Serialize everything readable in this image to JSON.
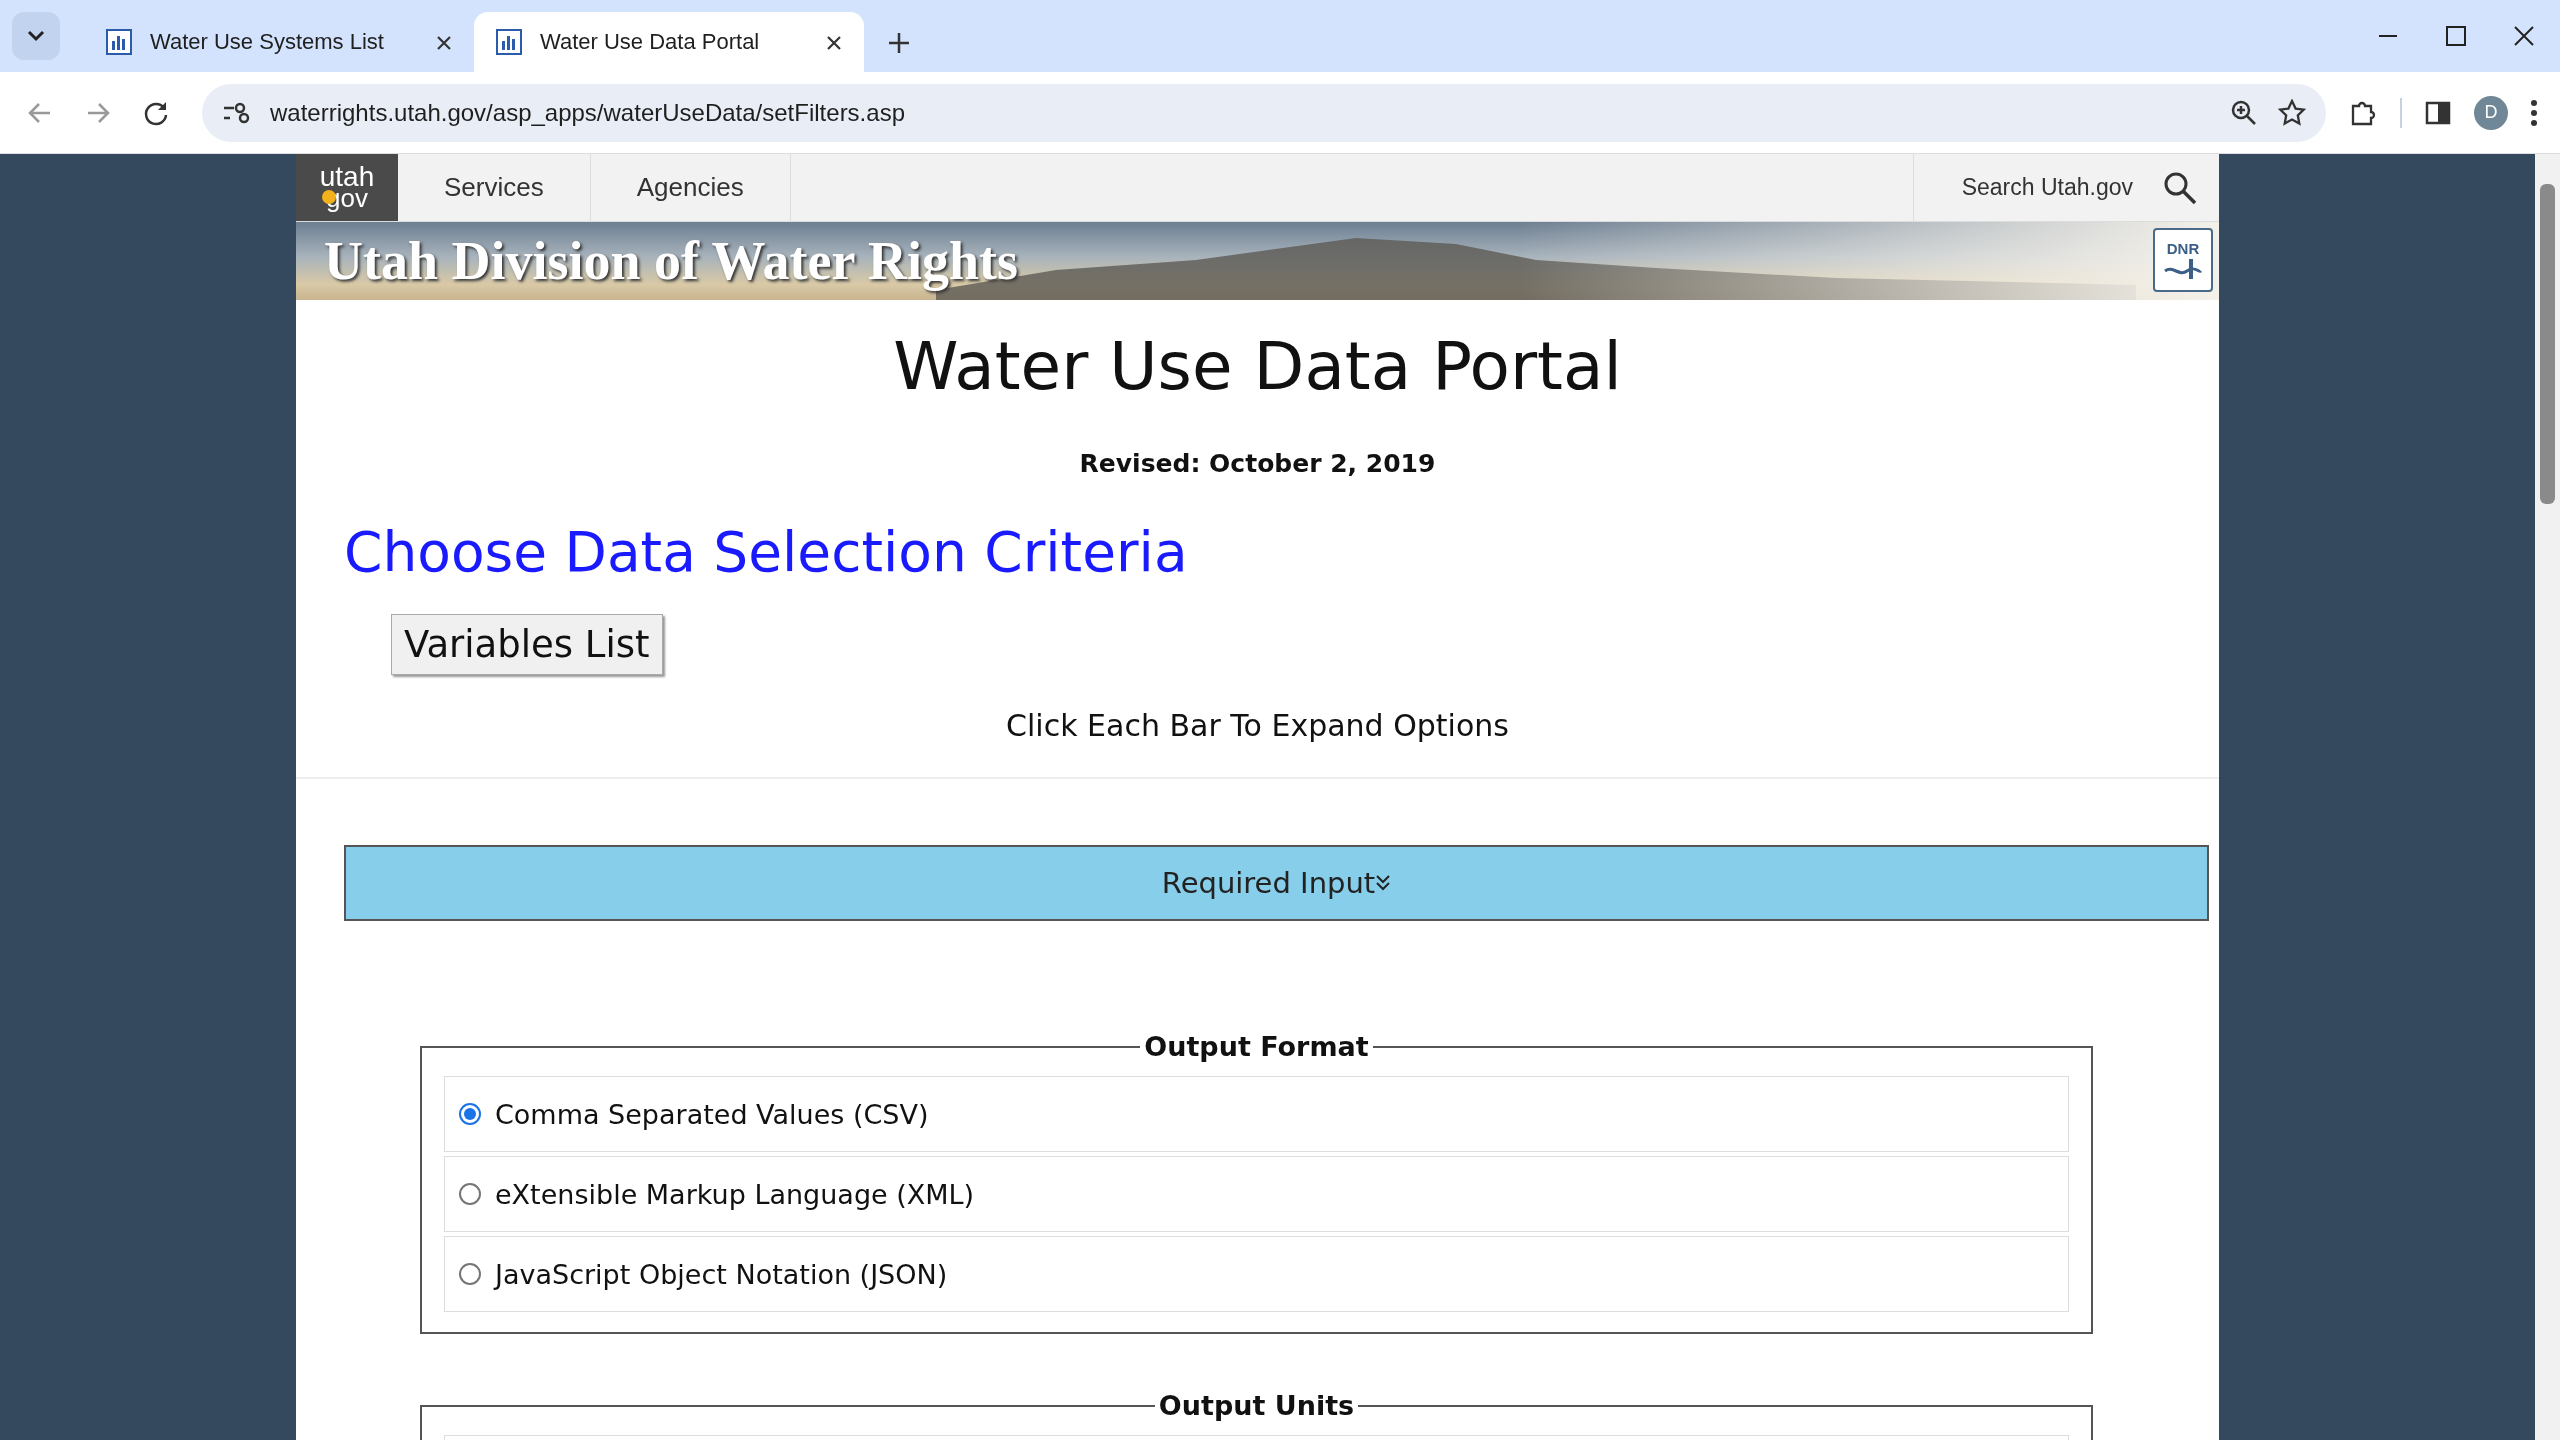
{
  "browser": {
    "tabs": [
      {
        "title": "Water Use Systems List",
        "selected": false
      },
      {
        "title": "Water Use Data Portal",
        "selected": true
      }
    ],
    "url": "waterrights.utah.gov/asp_apps/waterUseData/setFilters.asp",
    "profile_initial": "D"
  },
  "site_header": {
    "logo": {
      "top": "utah",
      "bottom": "gov"
    },
    "nav": [
      "Services",
      "Agencies"
    ],
    "search_label": "Search Utah.gov",
    "banner_title": "Utah Division of Water Rights",
    "badge": "DNR"
  },
  "page": {
    "title": "Water Use Data Portal",
    "revised": "Revised: October 2, 2019",
    "heading": "Choose Data Selection Criteria",
    "variables_button": "Variables List",
    "instructions": "Click Each Bar To Expand Options",
    "sections": [
      {
        "label": "Required Input",
        "expanded": true
      }
    ],
    "fieldsets": [
      {
        "legend": "Output Format",
        "options": [
          {
            "label": "Comma Separated Values (CSV)",
            "selected": true
          },
          {
            "label": "eXtensible Markup Language (XML)",
            "selected": false
          },
          {
            "label": "JavaScript Object Notation (JSON)",
            "selected": false
          }
        ]
      },
      {
        "legend": "Output Units"
      }
    ]
  }
}
